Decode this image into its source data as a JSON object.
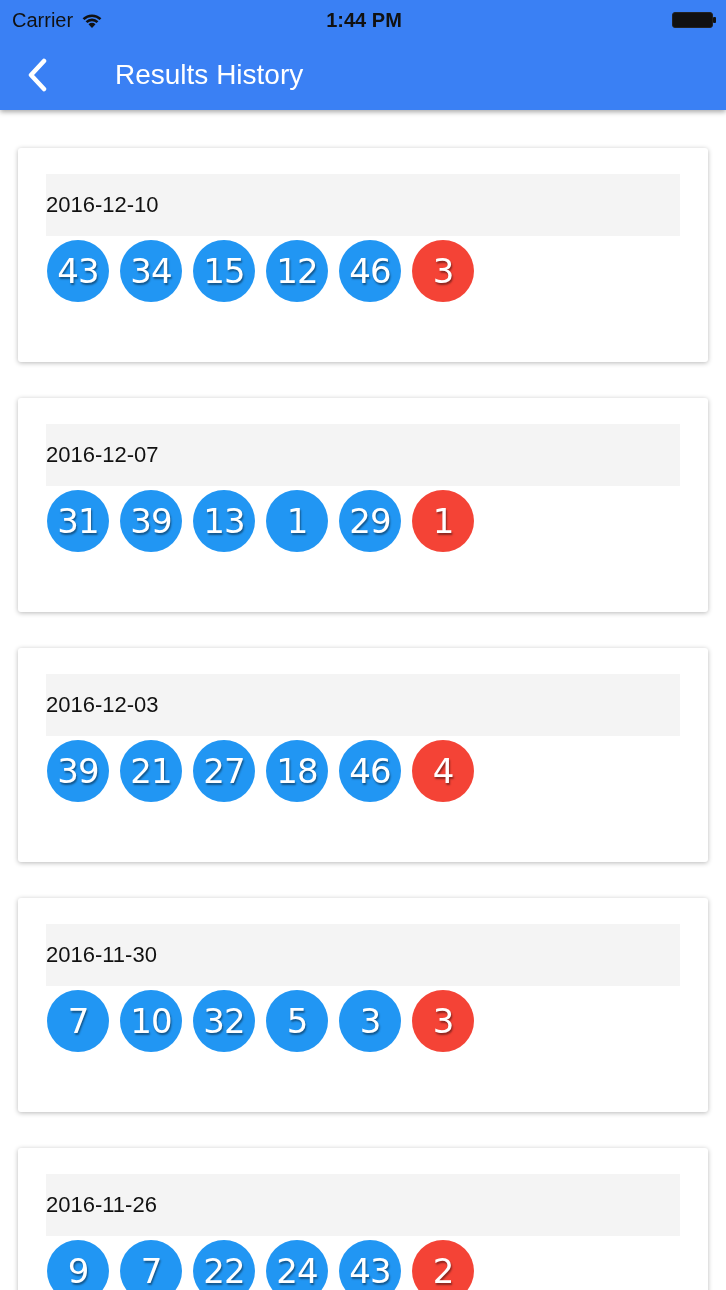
{
  "status_bar": {
    "carrier": "Carrier",
    "time": "1:44 PM"
  },
  "nav_bar": {
    "title": "Results History"
  },
  "draws": [
    {
      "date": "2016-12-10",
      "balls": [
        {
          "number": "43",
          "color": "#2196f3"
        },
        {
          "number": "34",
          "color": "#2196f3"
        },
        {
          "number": "15",
          "color": "#2196f3"
        },
        {
          "number": "12",
          "color": "#2196f3"
        },
        {
          "number": "46",
          "color": "#2196f3"
        },
        {
          "number": "3",
          "color": "#f44336"
        }
      ]
    },
    {
      "date": "2016-12-07",
      "balls": [
        {
          "number": "31",
          "color": "#2196f3"
        },
        {
          "number": "39",
          "color": "#2196f3"
        },
        {
          "number": "13",
          "color": "#2196f3"
        },
        {
          "number": "1",
          "color": "#2196f3"
        },
        {
          "number": "29",
          "color": "#2196f3"
        },
        {
          "number": "1",
          "color": "#f44336"
        }
      ]
    },
    {
      "date": "2016-12-03",
      "balls": [
        {
          "number": "39",
          "color": "#2196f3"
        },
        {
          "number": "21",
          "color": "#2196f3"
        },
        {
          "number": "27",
          "color": "#2196f3"
        },
        {
          "number": "18",
          "color": "#2196f3"
        },
        {
          "number": "46",
          "color": "#2196f3"
        },
        {
          "number": "4",
          "color": "#f44336"
        }
      ]
    },
    {
      "date": "2016-11-30",
      "balls": [
        {
          "number": "7",
          "color": "#2196f3"
        },
        {
          "number": "10",
          "color": "#2196f3"
        },
        {
          "number": "32",
          "color": "#2196f3"
        },
        {
          "number": "5",
          "color": "#2196f3"
        },
        {
          "number": "3",
          "color": "#2196f3"
        },
        {
          "number": "3",
          "color": "#f44336"
        }
      ]
    },
    {
      "date": "2016-11-26",
      "balls": [
        {
          "number": "9",
          "color": "#2196f3"
        },
        {
          "number": "7",
          "color": "#2196f3"
        },
        {
          "number": "22",
          "color": "#2196f3"
        },
        {
          "number": "24",
          "color": "#2196f3"
        },
        {
          "number": "43",
          "color": "#2196f3"
        },
        {
          "number": "2",
          "color": "#f44336"
        }
      ]
    }
  ]
}
